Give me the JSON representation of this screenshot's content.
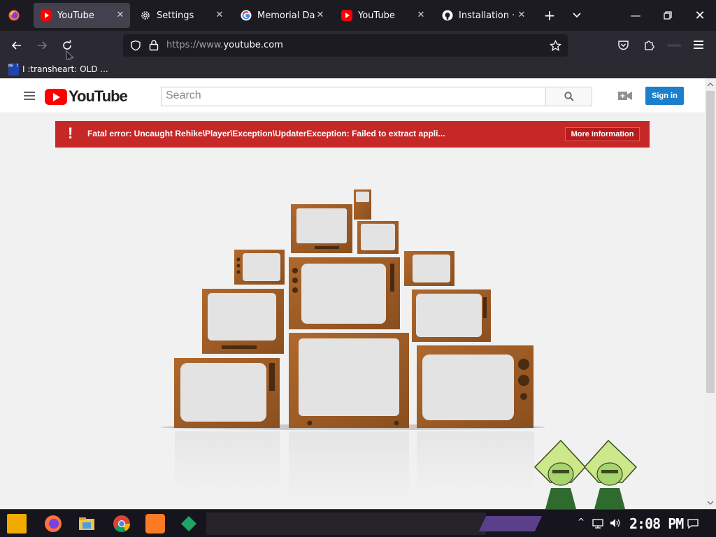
{
  "browser": {
    "tabs": [
      {
        "label": "YouTube",
        "icon": "youtube-icon",
        "active": true
      },
      {
        "label": "Settings",
        "icon": "gear-icon",
        "active": false
      },
      {
        "label": "Memorial Day -",
        "icon": "google-icon",
        "active": false
      },
      {
        "label": "YouTube",
        "icon": "youtube-icon",
        "active": false
      },
      {
        "label": "Installation · Re",
        "icon": "github-icon",
        "active": false
      }
    ],
    "url_dim": "https://www.",
    "url_main": "youtube.com",
    "bookmark_icon_text": "MF T",
    "bookmark_label": "I :transheart: OLD ..."
  },
  "youtube": {
    "logo_text": "YouTube",
    "search_placeholder": "Search",
    "signin_label": "Sign in",
    "error_icon": "!",
    "error_message": "Fatal error: Uncaught Rehike\\Player\\Exception\\UpdaterException: Failed to extract appli...",
    "more_info_label": "More information"
  },
  "taskbar": {
    "clock": "2:08 PM"
  },
  "colors": {
    "accent_blue": "#1b7fcc",
    "error_red": "#c62828",
    "youtube_red": "#ff0000"
  }
}
